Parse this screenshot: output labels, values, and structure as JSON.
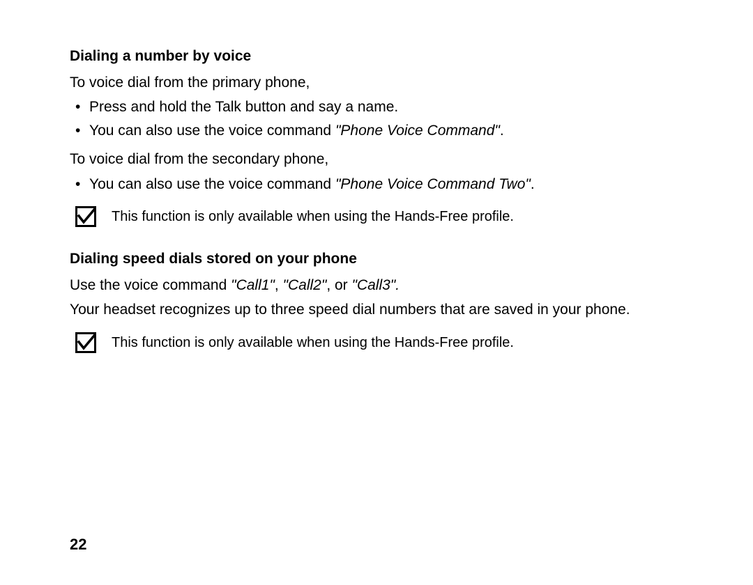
{
  "section1": {
    "heading": "Dialing a number by voice",
    "intro1": "To voice dial from the primary phone,",
    "bullets1": [
      {
        "plain": "Press and hold the Talk button and say a name.",
        "italic": ""
      },
      {
        "plain": "You can also use the voice command ",
        "italic": "\"Phone Voice Command\"",
        "after": "."
      }
    ],
    "intro2": "To voice dial from the secondary phone,",
    "bullets2": [
      {
        "plain": "You can also use the voice command ",
        "italic": "\"Phone Voice Command Two\"",
        "after": "."
      }
    ],
    "note": "This function is only available when using the Hands-Free profile."
  },
  "section2": {
    "heading": "Dialing speed dials stored on your phone",
    "line1_pre": "Use the voice command ",
    "line1_i1": "\"Call1\"",
    "line1_mid1": ", ",
    "line1_i2": "\"Call2\"",
    "line1_mid2": ", or ",
    "line1_i3": "\"Call3\".",
    "line2": "Your headset recognizes up to three speed dial numbers that are saved in your phone.",
    "note": "This function is only available when using the Hands-Free profile."
  },
  "pageNumber": "22",
  "icons": {
    "check": "check-icon"
  }
}
